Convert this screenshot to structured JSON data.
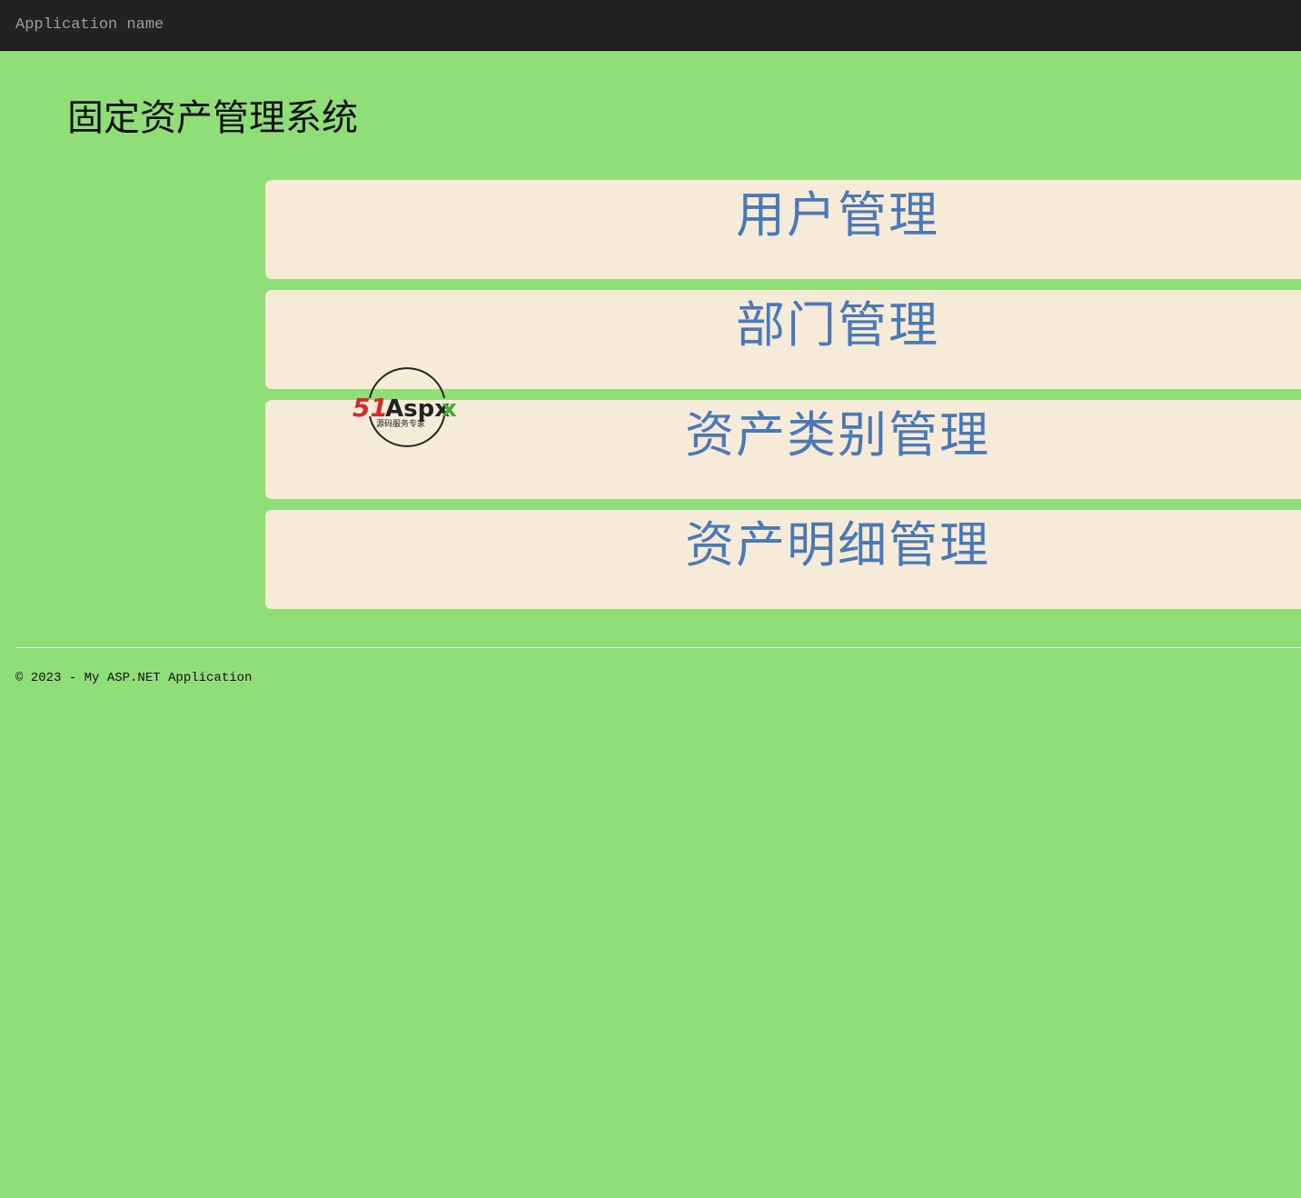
{
  "navbar": {
    "brand": "Application name"
  },
  "page": {
    "title": "固定资产管理系统"
  },
  "menu": {
    "items": [
      {
        "label": "用户管理"
      },
      {
        "label": "部门管理"
      },
      {
        "label": "资产类别管理"
      },
      {
        "label": "资产明细管理"
      }
    ]
  },
  "watermark": {
    "logo_text": "51Aspx",
    "logo_subtext": "源码服务专家",
    "colors": {
      "red": "#d42a2a",
      "green": "#3fae3a",
      "dark": "#222222"
    }
  },
  "footer": {
    "copyright": "© 2023 - My ASP.NET Application"
  },
  "colors": {
    "background": "#90de78",
    "navbar": "#222222",
    "card": "#f6ebd9",
    "card_text": "#4a79b5"
  }
}
